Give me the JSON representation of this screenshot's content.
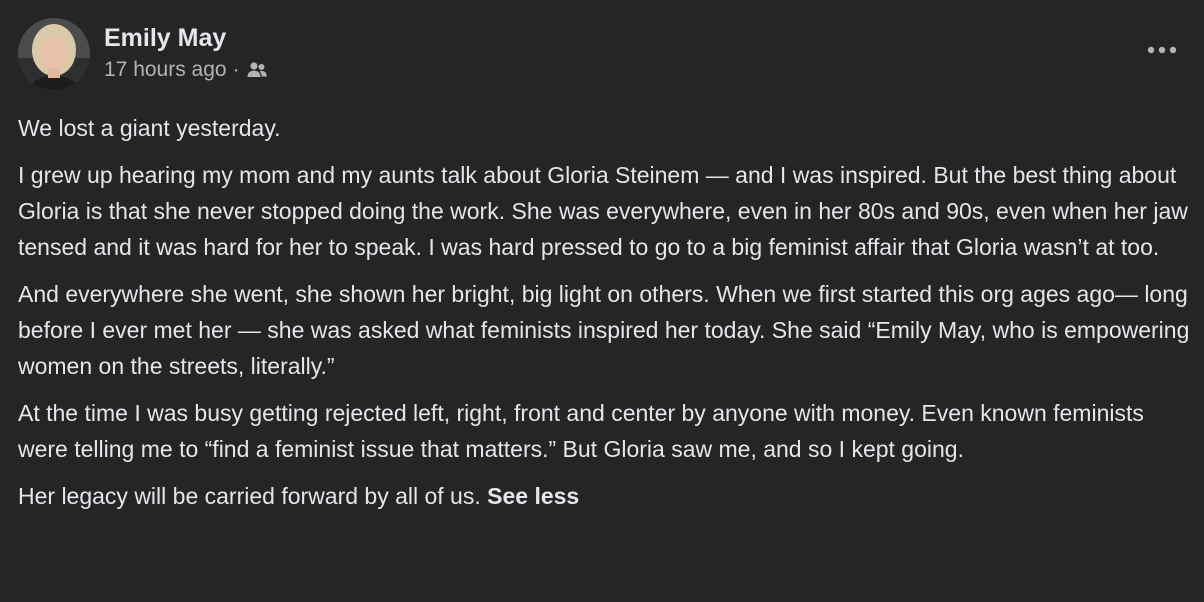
{
  "post": {
    "author": "Emily May",
    "timestamp": "17 hours ago",
    "separator": "·",
    "audience_icon": "friends-icon",
    "more_icon": "more-options-icon",
    "paragraphs": [
      "We lost a giant yesterday.",
      "I grew up hearing my mom and my aunts talk about Gloria Steinem — and I was inspired. But the best thing about Gloria is that she never stopped doing the work. She was everywhere, even in her 80s and 90s, even when her jaw tensed and it was hard for her to speak. I was hard pressed to go to a big feminist affair that Gloria wasn’t at too.",
      "And everywhere she went, she shown her bright, big light on others. When we first started this org ages ago— long before I ever met her — she was asked what feminists inspired her today. She said “Emily May, who is empowering women on the streets, literally.”",
      "At the time I was busy getting rejected left, right, front and center by anyone with money. Even known feminists were telling me to “find a feminist issue that matters.” But Gloria saw me, and so I kept going.",
      "Her legacy will be carried forward by all of us."
    ],
    "see_less_label": "See less"
  },
  "colors": {
    "background": "#252526",
    "primary_text": "#e4e6eb",
    "secondary_text": "#b0b3b8"
  }
}
